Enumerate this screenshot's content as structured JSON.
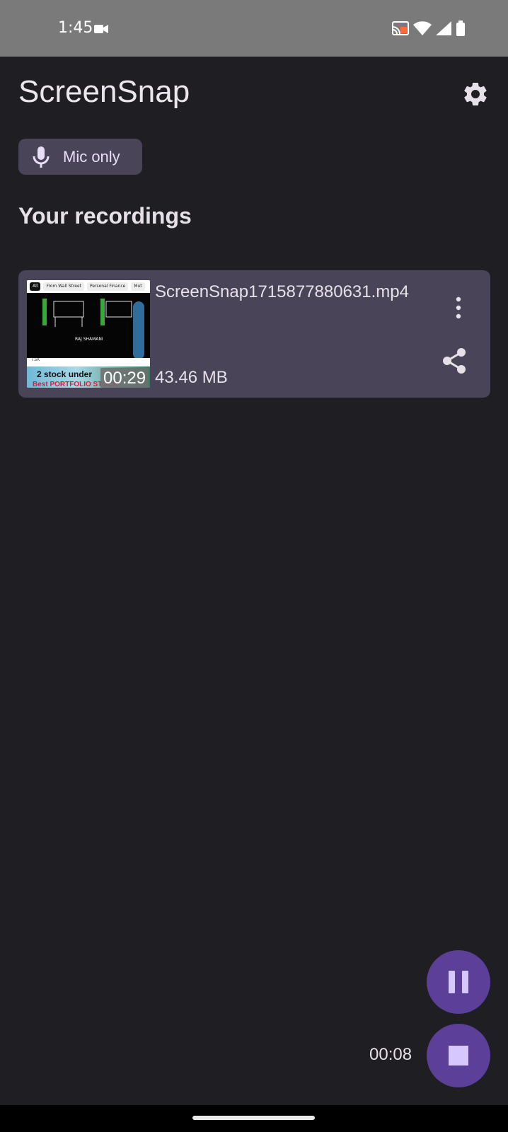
{
  "status_bar": {
    "time": "1:45",
    "icons": [
      "video-camera-icon",
      "cast-icon",
      "wifi-icon",
      "signal-icon",
      "battery-icon"
    ]
  },
  "app": {
    "title": "ScreenSnap",
    "settings_icon": "gear-icon"
  },
  "audio_chip": {
    "label": "Mic only",
    "icon": "microphone-icon"
  },
  "recordings": {
    "section_title": "Your recordings",
    "items": [
      {
        "file_name": "ScreenSnap1715877880631.mp4",
        "size": "43.46 MB",
        "duration": "00:29",
        "thumbnail": {
          "tabs": [
            "All",
            "From Wall Street",
            "Personal Finance",
            "Mut"
          ],
          "channel": "RAJ SHAMANI",
          "likes": "7.5K",
          "ad_line1": "2 stock under",
          "ad_line2": "Best PORTFOLIO STOCK"
        }
      }
    ]
  },
  "recording_controls": {
    "elapsed": "00:08",
    "pause_icon": "pause-icon",
    "stop_icon": "stop-icon"
  },
  "colors": {
    "background": "#1f1e22",
    "status_bar": "#7a7a7a",
    "card": "#4a4458",
    "fab": "#5b3f98",
    "fab_icon": "#d6c8ff"
  }
}
